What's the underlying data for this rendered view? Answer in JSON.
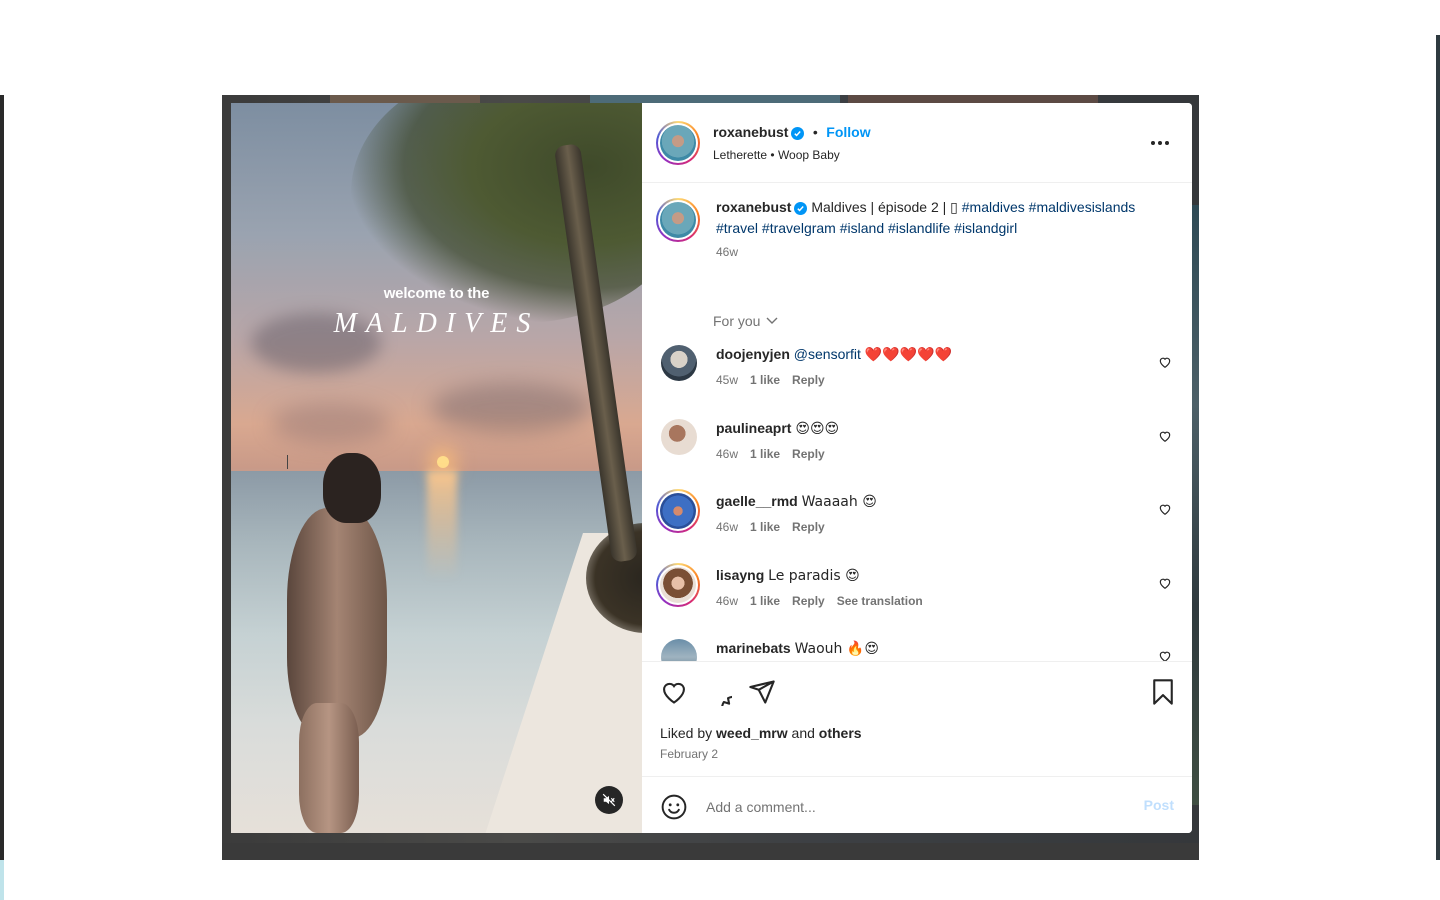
{
  "post": {
    "author": "roxanebust",
    "follow_label": "Follow",
    "dot": "•",
    "audio_artist": "Letherette",
    "audio_track": "Woop Baby",
    "media_overlay": {
      "line1": "welcome to the",
      "line2": "MALDIVES"
    },
    "caption": {
      "username": "roxanebust",
      "text": "Maldives | épisode 2 | ▯",
      "hashtags": [
        "#maldives",
        "#maldivesislands",
        "#travel",
        "#travelgram",
        "#island",
        "#islandlife",
        "#islandgirl"
      ],
      "age": "46w"
    },
    "sort_label": "For you",
    "comments": [
      {
        "username": "doojenyjen",
        "mention": "@sensorfit",
        "text": "❤️❤️❤️❤️❤️",
        "age": "45w",
        "likes": "1 like",
        "reply": "Reply",
        "avatar": "av-dooj",
        "ring": false
      },
      {
        "username": "paulineaprt",
        "mention": "",
        "text": "😍😍😍",
        "age": "46w",
        "likes": "1 like",
        "reply": "Reply",
        "avatar": "av-paul",
        "ring": false
      },
      {
        "username": "gaelle__rmd",
        "mention": "",
        "text": "Waaaah 😍",
        "age": "46w",
        "likes": "1 like",
        "reply": "Reply",
        "avatar": "av-gaelle",
        "ring": true
      },
      {
        "username": "lisayng",
        "mention": "",
        "text": "Le paradis 😍",
        "age": "46w",
        "likes": "1 like",
        "reply": "Reply",
        "translate": "See translation",
        "avatar": "av-lisa",
        "ring": true
      },
      {
        "username": "marinebats",
        "mention": "",
        "text": "Waouh 🔥😍",
        "age": "",
        "likes": "",
        "reply": "",
        "avatar": "av-marine",
        "ring": false
      }
    ],
    "liked_by_prefix": "Liked by",
    "liked_by_user": "weed_mrw",
    "liked_by_and": "and",
    "liked_by_others": "others",
    "date": "February 2",
    "add_comment_placeholder": "Add a comment...",
    "post_label": "Post"
  },
  "icons": {
    "verified": "verified-badge-icon",
    "more": "more-options-icon",
    "like": "heart-icon",
    "comment": "comment-bubble-icon",
    "share": "paper-plane-icon",
    "save": "bookmark-icon",
    "emoji": "smiley-icon",
    "mute": "muted-speaker-icon"
  },
  "colors": {
    "accent": "#0095f6",
    "hashtag": "#00376b",
    "muted": "#737373",
    "post_disabled": "#c0dffd"
  }
}
